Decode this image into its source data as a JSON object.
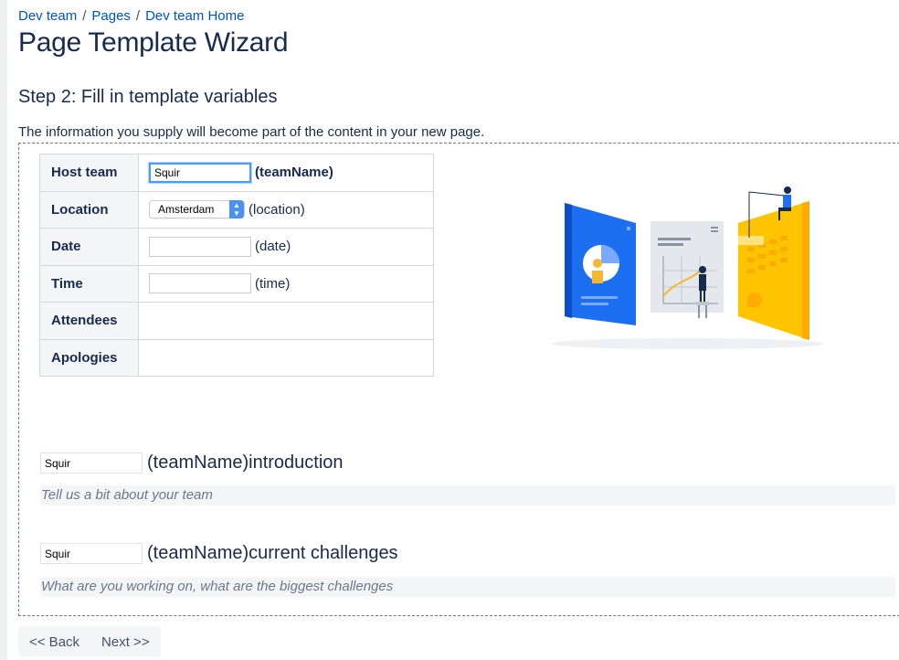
{
  "breadcrumb": [
    "Dev team",
    "Pages",
    "Dev team Home"
  ],
  "breadcrumb_separator": "/",
  "page_title": "Page Template Wizard",
  "step_title": "Step 2: Fill in template variables",
  "info_text": "The information you supply will become part of the content in your new page.",
  "variables": {
    "host_team": {
      "label": "Host team",
      "value": "Squir",
      "var": "(teamName)"
    },
    "location": {
      "label": "Location",
      "selected": "Amsterdam",
      "var": "(location)"
    },
    "date": {
      "label": "Date",
      "value": "",
      "var": "(date)"
    },
    "time": {
      "label": "Time",
      "value": "",
      "var": "(time)"
    },
    "attendees": {
      "label": "Attendees"
    },
    "apologies": {
      "label": "Apologies"
    }
  },
  "intro_section": {
    "value": "Squir",
    "label": "(teamName)introduction",
    "hint": "Tell us a bit about your team"
  },
  "challenges_section": {
    "value": "Squir",
    "label": "(teamName)current challenges",
    "hint": "What are you working on, what are the biggest challenges"
  },
  "buttons": {
    "back": "<< Back",
    "next": "Next >>"
  },
  "colors": {
    "link": "#0052cc",
    "text": "#172b4d",
    "focus": "#4c9aff",
    "select_accent": "#4a90f5"
  }
}
